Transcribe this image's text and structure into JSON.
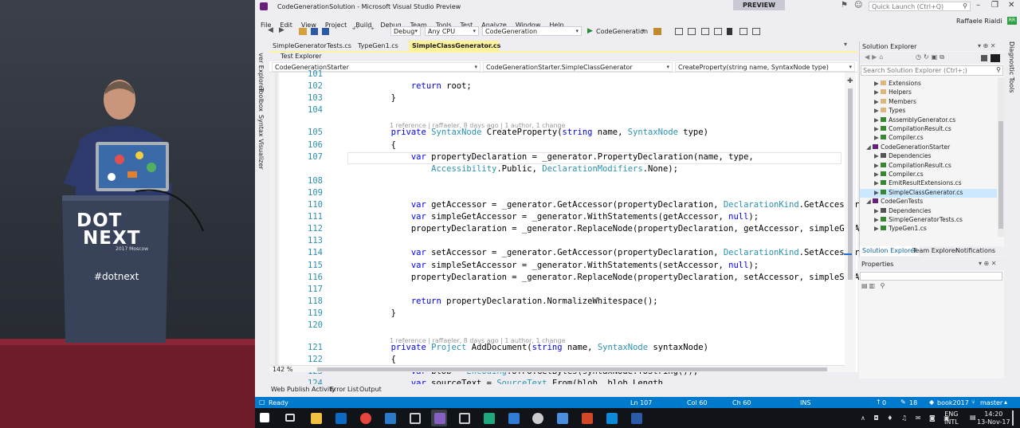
{
  "window": {
    "title": "CodeGenerationSolution - Microsoft Visual Studio Preview",
    "preview_badge": "PREVIEW",
    "quick_launch_placeholder": "Quick Launch (Ctrl+Q)",
    "user": "Raffaele Rialdi",
    "user_initials": "RR"
  },
  "menu": [
    "File",
    "Edit",
    "View",
    "Project",
    "Build",
    "Debug",
    "Team",
    "Tools",
    "Test",
    "Analyze",
    "Window",
    "Help"
  ],
  "toolbar": {
    "config": "Debug",
    "platform": "Any CPU",
    "project": "CodeGeneration",
    "start_label": "CodeGeneration"
  },
  "side_tabs_left": [
    "Server Explorer",
    "Toolbox",
    "Syntax Visualizer"
  ],
  "side_tabs_right": [
    "Diagnostic Tools"
  ],
  "doc_tabs": [
    {
      "label": "SimpleGeneratorTests.cs",
      "active": false
    },
    {
      "label": "TypeGen1.cs",
      "active": false
    },
    {
      "label": "SimpleClassGenerator.cs",
      "active": true
    }
  ],
  "subtab": "Test Explorer",
  "nav": {
    "project": "CodeGenerationStarter",
    "type": "CodeGenerationStarter.SimpleClassGenerator",
    "member": "CreateProperty(string name, SyntaxNode type)"
  },
  "code_lines": [
    {
      "n": "101",
      "t": ""
    },
    {
      "n": "102",
      "t": "            return root;"
    },
    {
      "n": "103",
      "t": "        }"
    },
    {
      "n": "104",
      "t": ""
    },
    {
      "n": "105",
      "t": "        private SyntaxNode CreateProperty(string name, SyntaxNode type)",
      "lens": "1 reference | raffaeler, 8 days ago | 1 author, 1 change"
    },
    {
      "n": "106",
      "t": "        {"
    },
    {
      "n": "107",
      "t": "            var propertyDeclaration = _generator.PropertyDeclaration(name, type,"
    },
    {
      "n": "",
      "t": "                Accessibility.Public, DeclarationModifiers.None);"
    },
    {
      "n": "108",
      "t": ""
    },
    {
      "n": "109",
      "t": ""
    },
    {
      "n": "110",
      "t": "            var getAccessor = _generator.GetAccessor(propertyDeclaration, DeclarationKind.GetAccessor"
    },
    {
      "n": "111",
      "t": "            var simpleGetAccessor = _generator.WithStatements(getAccessor, null);"
    },
    {
      "n": "112",
      "t": "            propertyDeclaration = _generator.ReplaceNode(propertyDeclaration, getAccessor, simpleGetA"
    },
    {
      "n": "113",
      "t": ""
    },
    {
      "n": "114",
      "t": "            var setAccessor = _generator.GetAccessor(propertyDeclaration, DeclarationKind.SetAccessor"
    },
    {
      "n": "115",
      "t": "            var simpleSetAccessor = _generator.WithStatements(setAccessor, null);"
    },
    {
      "n": "116",
      "t": "            propertyDeclaration = _generator.ReplaceNode(propertyDeclaration, setAccessor, simpleSetA"
    },
    {
      "n": "117",
      "t": ""
    },
    {
      "n": "118",
      "t": "            return propertyDeclaration.NormalizeWhitespace();"
    },
    {
      "n": "119",
      "t": "        }"
    },
    {
      "n": "120",
      "t": ""
    },
    {
      "n": "121",
      "t": "        private Project AddDocument(string name, SyntaxNode syntaxNode)",
      "lens": "1 reference | raffaeler, 8 days ago | 1 author, 1 change"
    },
    {
      "n": "122",
      "t": "        {"
    },
    {
      "n": "123",
      "t": "            var blob = Encoding.UTF8.GetBytes(syntaxNode.ToString());"
    },
    {
      "n": "124",
      "t": "            var sourceText = SourceText.From(blob, blob.Length,"
    }
  ],
  "zoom": "142 %",
  "solution_explorer": {
    "title": "Solution Explorer",
    "search_placeholder": "Search Solution Explorer (Ctrl+;)",
    "items": [
      {
        "label": "Extensions",
        "depth": 1,
        "kind": "folder"
      },
      {
        "label": "Helpers",
        "depth": 1,
        "kind": "folder"
      },
      {
        "label": "Members",
        "depth": 1,
        "kind": "folder"
      },
      {
        "label": "Types",
        "depth": 1,
        "kind": "folder"
      },
      {
        "label": "AssemblyGenerator.cs",
        "depth": 1,
        "kind": "cs"
      },
      {
        "label": "CompilationResult.cs",
        "depth": 1,
        "kind": "cs"
      },
      {
        "label": "Compiler.cs",
        "depth": 1,
        "kind": "cs"
      },
      {
        "label": "CodeGenerationStarter",
        "depth": 0,
        "kind": "proj"
      },
      {
        "label": "Dependencies",
        "depth": 1,
        "kind": "dep"
      },
      {
        "label": "CompilationResult.cs",
        "depth": 1,
        "kind": "cs"
      },
      {
        "label": "Compiler.cs",
        "depth": 1,
        "kind": "cs"
      },
      {
        "label": "EmitResultExtensions.cs",
        "depth": 1,
        "kind": "cs"
      },
      {
        "label": "SimpleClassGenerator.cs",
        "depth": 1,
        "kind": "cs",
        "selected": true
      },
      {
        "label": "CodeGenTests",
        "depth": 0,
        "kind": "proj"
      },
      {
        "label": "Dependencies",
        "depth": 1,
        "kind": "dep"
      },
      {
        "label": "SimpleGeneratorTests.cs",
        "depth": 1,
        "kind": "cs"
      },
      {
        "label": "TypeGen1.cs",
        "depth": 1,
        "kind": "cs"
      }
    ],
    "bottom_tabs": [
      "Solution Explorer",
      "Team Explorer",
      "Notifications"
    ]
  },
  "properties": {
    "title": "Properties"
  },
  "output_tabs": [
    "Web Publish Activity",
    "Error List",
    "Output"
  ],
  "status": {
    "ready": "Ready",
    "ln": "Ln 107",
    "col": "Col 60",
    "ch": "Ch 60",
    "ins": "INS",
    "errors": "0",
    "changes": "18",
    "repo": "book2017",
    "branch": "master"
  },
  "clock": {
    "time": "14:20",
    "date": "13-Nov-17",
    "lang": "ENG",
    "layout": "INTL"
  },
  "stage": {
    "brand_line1": "DOT",
    "brand_line2": "NEXT",
    "brand_sub": "2017 Moscow",
    "hashtag": "#dotnext"
  },
  "colors": {
    "accent": "#007acc",
    "active_tab": "#fff29d",
    "purple_brand": "#68217a"
  }
}
